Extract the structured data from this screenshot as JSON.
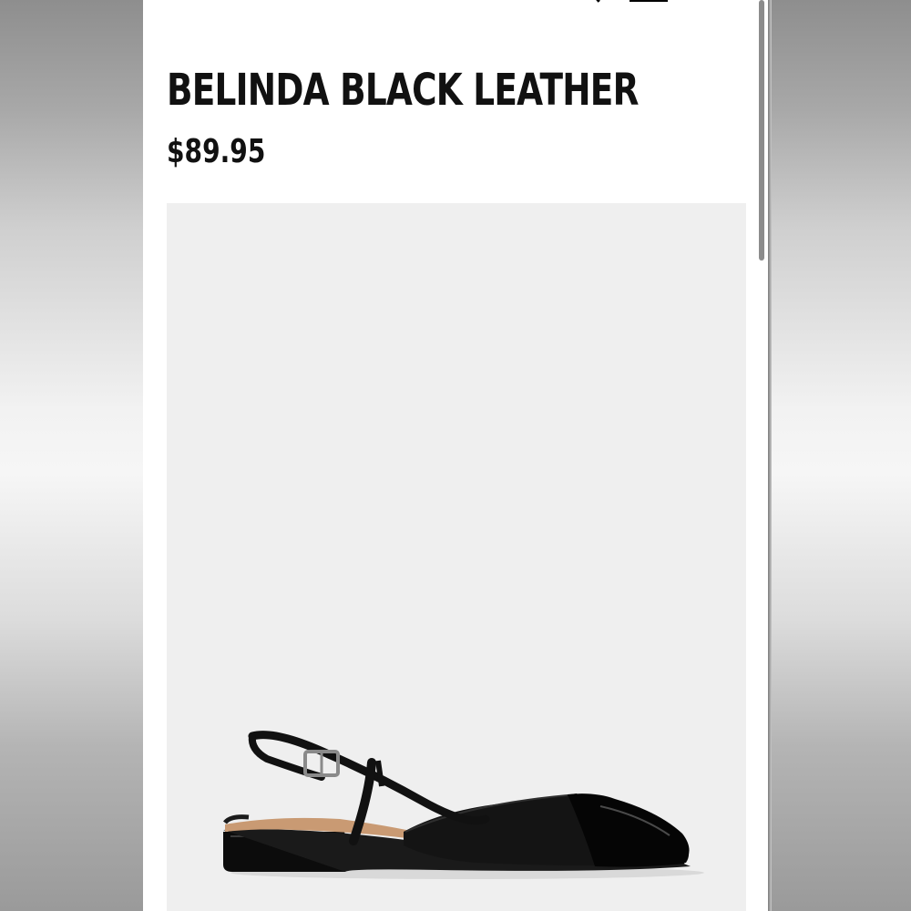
{
  "product": {
    "name": "BELINDA BLACK LEATHER",
    "price": "$89.95",
    "image_icon": "slingback-flat-shoe"
  },
  "header": {
    "icons": [
      "search-icon",
      "bag-icon"
    ]
  },
  "colors": {
    "background": "#ffffff",
    "image_background": "#efefef",
    "text": "#111111"
  }
}
